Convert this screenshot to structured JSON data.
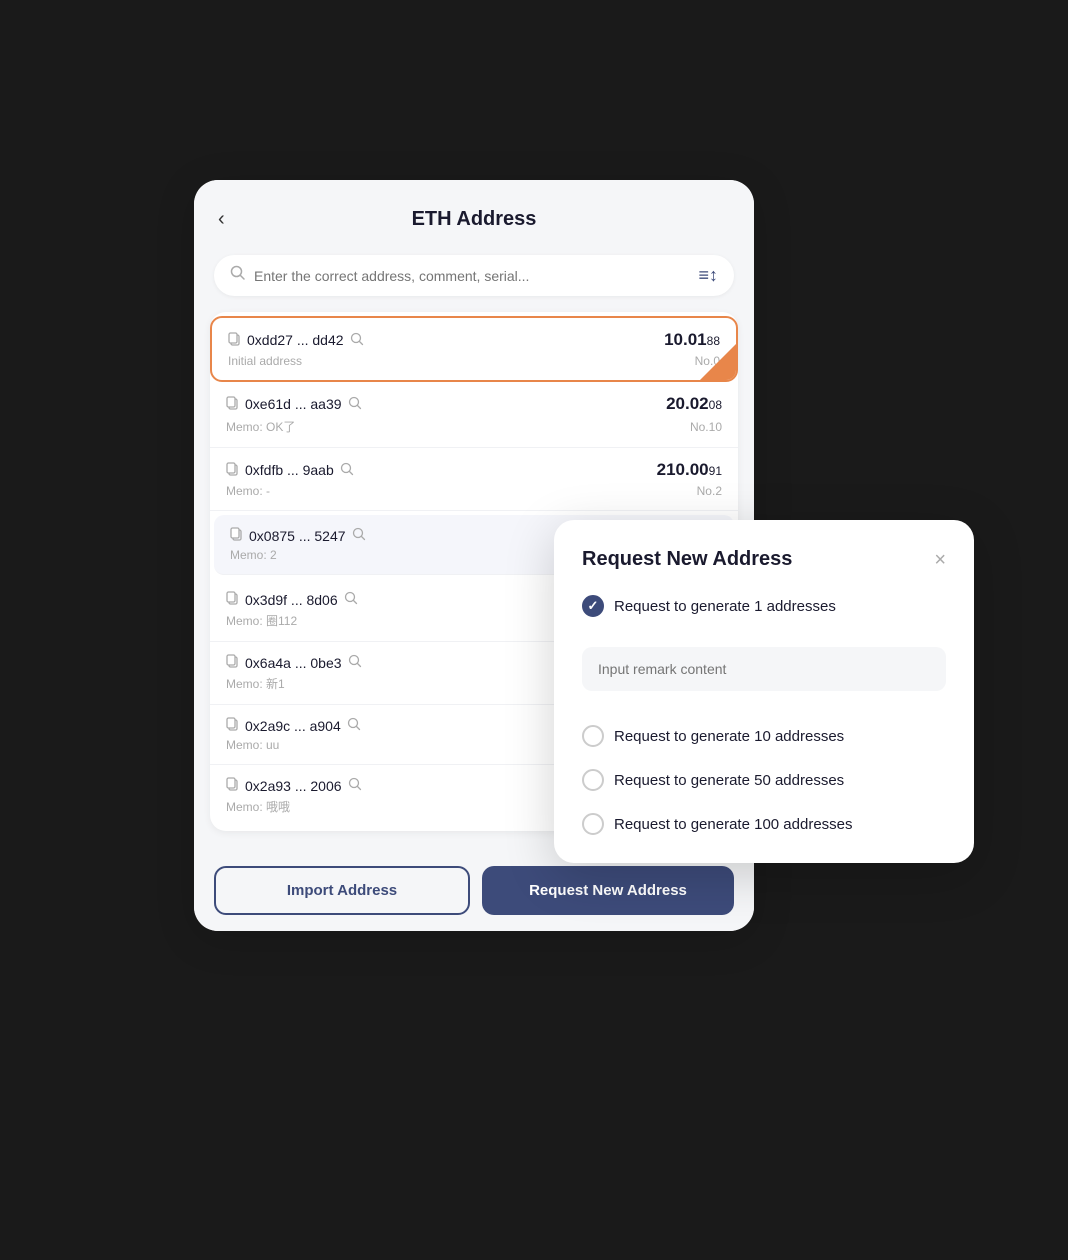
{
  "header": {
    "title": "ETH Address",
    "back_label": "‹"
  },
  "search": {
    "placeholder": "Enter the correct address, comment, serial...",
    "filter_icon": "≡↕"
  },
  "addresses": [
    {
      "id": 0,
      "address": "0xdd27 ... dd42",
      "memo": "Initial address",
      "balance_main": "10.01",
      "balance_small": "88",
      "serial": "No.0",
      "selected": true
    },
    {
      "id": 1,
      "address": "0xe61d ... aa39",
      "memo": "Memo: OK了",
      "balance_main": "20.02",
      "balance_small": "08",
      "serial": "No.10",
      "selected": false
    },
    {
      "id": 2,
      "address": "0xfdfb ... 9aab",
      "memo": "Memo: -",
      "balance_main": "210.00",
      "balance_small": "91",
      "serial": "No.2",
      "selected": false
    },
    {
      "id": 3,
      "address": "0x0875 ... 5247",
      "memo": "Memo: 2",
      "balance_main": "",
      "balance_small": "",
      "serial": "",
      "selected": false
    },
    {
      "id": 4,
      "address": "0x3d9f ... 8d06",
      "memo": "Memo: 圈112",
      "balance_main": "",
      "balance_small": "",
      "serial": "",
      "selected": false
    },
    {
      "id": 5,
      "address": "0x6a4a ... 0be3",
      "memo": "Memo: 新1",
      "balance_main": "",
      "balance_small": "",
      "serial": "",
      "selected": false
    },
    {
      "id": 6,
      "address": "0x2a9c ... a904",
      "memo": "Memo: uu",
      "balance_main": "",
      "balance_small": "",
      "serial": "",
      "selected": false
    },
    {
      "id": 7,
      "address": "0x2a93 ... 2006",
      "memo": "Memo: 哦哦",
      "balance_main": "",
      "balance_small": "",
      "serial": "",
      "selected": false
    }
  ],
  "buttons": {
    "import": "Import Address",
    "request": "Request New Address"
  },
  "modal": {
    "title": "Request New Address",
    "close_icon": "×",
    "remark_placeholder": "Input remark content",
    "options": [
      {
        "label": "Request to generate 1 addresses",
        "checked": true
      },
      {
        "label": "Request to generate 10 addresses",
        "checked": false
      },
      {
        "label": "Request to generate 50 addresses",
        "checked": false
      },
      {
        "label": "Request to generate 100 addresses",
        "checked": false
      }
    ]
  }
}
